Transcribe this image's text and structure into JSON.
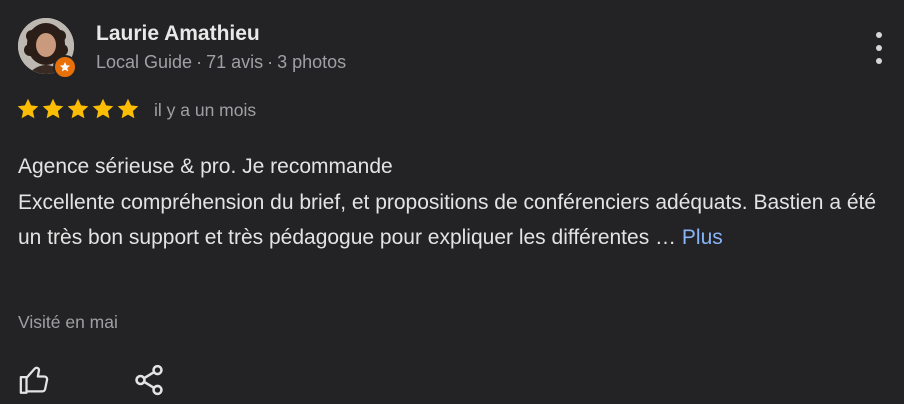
{
  "reviewer": {
    "name": "Laurie Amathieu",
    "level": "Local Guide",
    "reviews_count": "71 avis",
    "photos_count": "3 photos",
    "separator": "·"
  },
  "rating": {
    "stars": 5,
    "time_ago": "il y a un mois"
  },
  "review": {
    "line1": "Agence sérieuse & pro. Je recommande",
    "line2": "Excellente compréhension du brief, et propositions de conférenciers adéquats. Bastien a été un très bon support et très pédagogue pour expliquer les différentes …",
    "more_label": "Plus"
  },
  "visited": "Visité en mai",
  "icons": {
    "more": "more-vert-icon",
    "like": "thumb-up-icon",
    "share": "share-icon",
    "star": "star-icon",
    "badge": "local-guide-star-icon"
  },
  "colors": {
    "background": "#232325",
    "star": "#fbbc04",
    "link": "#8ab4f8",
    "badge": "#e8710a"
  }
}
